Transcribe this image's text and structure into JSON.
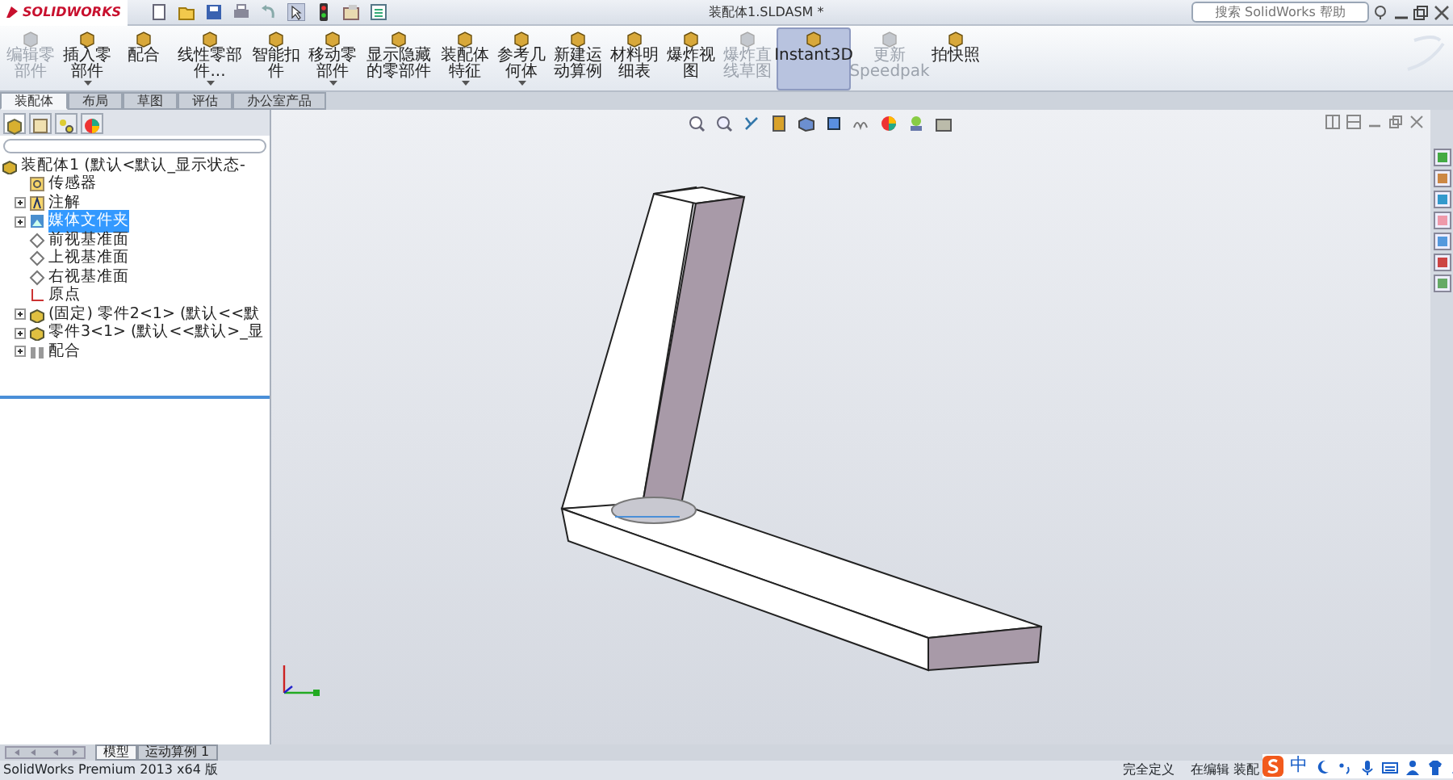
{
  "title_bar": {
    "logo": "SOLIDWORKS",
    "document_title": "装配体1.SLDASM *",
    "search": {
      "placeholder": "搜索 SolidWorks 帮助"
    }
  },
  "ribbon": {
    "buttons": [
      {
        "label": "编辑零部件",
        "disabled": true,
        "selected": false,
        "dropdown": false
      },
      {
        "label": "插入零部件",
        "disabled": false,
        "selected": false,
        "dropdown": true
      },
      {
        "label": "配合",
        "disabled": false,
        "selected": false,
        "dropdown": false
      },
      {
        "label": "线性零部件...",
        "disabled": false,
        "selected": false,
        "dropdown": true
      },
      {
        "label": "智能扣件",
        "disabled": false,
        "selected": false,
        "dropdown": false
      },
      {
        "label": "移动零部件",
        "disabled": false,
        "selected": false,
        "dropdown": true
      },
      {
        "label": "显示隐藏的零部件",
        "disabled": false,
        "selected": false,
        "dropdown": false
      },
      {
        "label": "装配体特征",
        "disabled": false,
        "selected": false,
        "dropdown": true
      },
      {
        "label": "参考几何体",
        "disabled": false,
        "selected": false,
        "dropdown": true
      },
      {
        "label": "新建运动算例",
        "disabled": false,
        "selected": false,
        "dropdown": false
      },
      {
        "label": "材料明细表",
        "disabled": false,
        "selected": false,
        "dropdown": false
      },
      {
        "label": "爆炸视图",
        "disabled": false,
        "selected": false,
        "dropdown": false
      },
      {
        "label": "爆炸直线草图",
        "disabled": true,
        "selected": false,
        "dropdown": false
      },
      {
        "label": "Instant3D",
        "disabled": false,
        "selected": true,
        "dropdown": false
      },
      {
        "label": "更新Speedpak",
        "disabled": true,
        "selected": false,
        "dropdown": false
      },
      {
        "label": "拍快照",
        "disabled": false,
        "selected": false,
        "dropdown": false
      }
    ]
  },
  "command_tabs": [
    {
      "label": "装配体",
      "selected": true
    },
    {
      "label": "布局",
      "selected": false
    },
    {
      "label": "草图",
      "selected": false
    },
    {
      "label": "评估",
      "selected": false
    },
    {
      "label": "办公室产品",
      "selected": false
    }
  ],
  "feature_tree": {
    "root": {
      "label": "装配体1 (默认<默认_显示状态-",
      "kind": "assembly",
      "children": [
        {
          "label": "传感器",
          "kind": "sensor",
          "collapsible": false,
          "selected": false
        },
        {
          "label": "注解",
          "kind": "annotation",
          "collapsible": true,
          "selected": false
        },
        {
          "label": "媒体文件夹",
          "kind": "folder",
          "collapsible": true,
          "selected": true
        },
        {
          "label": "前视基准面",
          "kind": "plane",
          "collapsible": false,
          "selected": false
        },
        {
          "label": "上视基准面",
          "kind": "plane",
          "collapsible": false,
          "selected": false
        },
        {
          "label": "右视基准面",
          "kind": "plane",
          "collapsible": false,
          "selected": false
        },
        {
          "label": "原点",
          "kind": "origin",
          "collapsible": false,
          "selected": false
        },
        {
          "label": "(固定) 零件2<1> (默认<<默",
          "kind": "part",
          "collapsible": true,
          "selected": false
        },
        {
          "label": "零件3<1> (默认<<默认>_显",
          "kind": "part",
          "collapsible": true,
          "selected": false
        },
        {
          "label": "配合",
          "kind": "mate",
          "collapsible": true,
          "selected": false
        }
      ]
    }
  },
  "bottom_tabs": [
    {
      "label": "模型",
      "selected": true
    },
    {
      "label": "运动算例 1",
      "selected": false
    }
  ],
  "status_bar": {
    "product": "SolidWorks Premium 2013 x64 版",
    "state": "完全定义",
    "mode": "在编辑 装配"
  },
  "ime_bar": {
    "mode": "中"
  }
}
